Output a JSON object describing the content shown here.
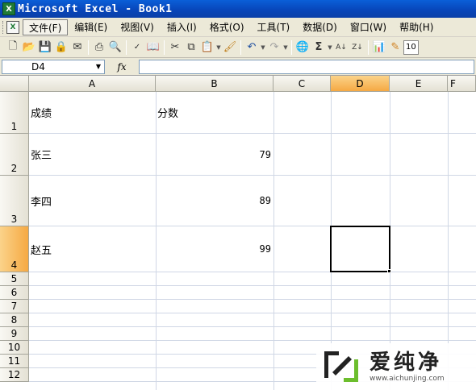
{
  "window": {
    "title": "Microsoft Excel - Book1",
    "app_icon": "excel-icon"
  },
  "menu": {
    "items": [
      {
        "label": "文件(F)",
        "active": true
      },
      {
        "label": "编辑(E)"
      },
      {
        "label": "视图(V)"
      },
      {
        "label": "插入(I)"
      },
      {
        "label": "格式(O)"
      },
      {
        "label": "工具(T)"
      },
      {
        "label": "数据(D)"
      },
      {
        "label": "窗口(W)"
      },
      {
        "label": "帮助(H)"
      }
    ]
  },
  "toolbar": {
    "icons": [
      "new-icon",
      "open-icon",
      "save-icon",
      "permission-icon",
      "email-icon",
      "print-icon",
      "print-preview-icon",
      "spelling-icon",
      "research-icon",
      "cut-icon",
      "copy-icon",
      "paste-icon",
      "format-painter-icon",
      "undo-icon",
      "redo-icon",
      "hyperlink-icon",
      "autosum-icon",
      "sort-ascending-icon",
      "sort-descending-icon",
      "chart-wizard-icon",
      "drawing-icon"
    ],
    "zoom": "10"
  },
  "formula_bar": {
    "name_box": "D4",
    "fx_label": "fx",
    "formula": ""
  },
  "columns": [
    "A",
    "B",
    "C",
    "D",
    "E",
    "F"
  ],
  "selected_column": "D",
  "rows": [
    "1",
    "2",
    "3",
    "4",
    "5",
    "6",
    "7",
    "8",
    "9",
    "10",
    "11",
    "12"
  ],
  "selected_row": "4",
  "cells": {
    "A1": "成绩",
    "B1": "分数",
    "A2": "张三",
    "B2": "79",
    "A3": "李四",
    "B3": "89",
    "A4": "赵五",
    "B4": "99"
  },
  "watermark": {
    "text": "爱纯净",
    "url": "www.aichunjing.com"
  },
  "colors": {
    "titlebar": "#0845b8",
    "selected_header": "#f5a943",
    "gridline": "#d0d7e5"
  }
}
